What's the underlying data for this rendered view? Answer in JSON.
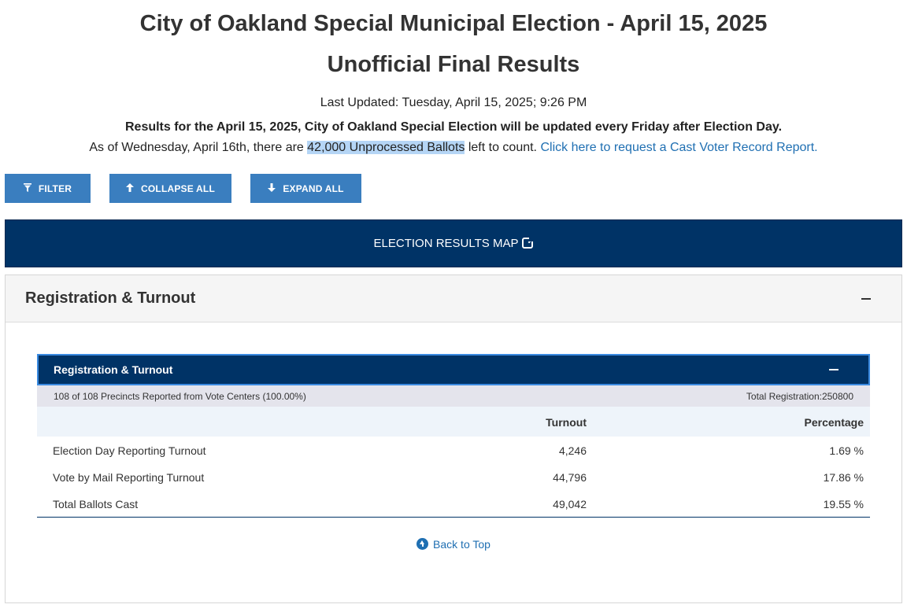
{
  "header": {
    "title": "City of Oakland Special Municipal Election - April 15, 2025",
    "subtitle": "Unofficial Final Results",
    "last_updated": "Last Updated: Tuesday, April 15, 2025; 9:26 PM",
    "bold_note": "Results for the April 15, 2025, City of Oakland Special Election will be updated every Friday after Election Day.",
    "as_of_prefix": "As of Wednesday, April 16th, there are ",
    "as_of_highlight": "42,000 Unprocessed Ballots",
    "as_of_suffix": " left to count. ",
    "cvr_link": "Click here to request a Cast Voter Record Report."
  },
  "toolbar": {
    "filter_label": "FILTER",
    "collapse_label": "COLLAPSE ALL",
    "expand_label": "EXPAND ALL"
  },
  "map_bar": {
    "label": "ELECTION RESULTS MAP"
  },
  "panel": {
    "title": "Registration & Turnout",
    "inner_title": "Registration & Turnout",
    "precincts": "108 of 108 Precincts Reported from Vote Centers (100.00%)",
    "total_registration": "Total Registration:250800",
    "columns": {
      "turnout": "Turnout",
      "percentage": "Percentage"
    },
    "rows": [
      {
        "label": "Election Day Reporting Turnout",
        "turnout": "4,246",
        "percentage": "1.69 %"
      },
      {
        "label": "Vote by Mail Reporting Turnout",
        "turnout": "44,796",
        "percentage": "17.86 %"
      },
      {
        "label": "Total Ballots Cast",
        "turnout": "49,042",
        "percentage": "19.55 %"
      }
    ],
    "back_to_top": "Back to Top"
  },
  "icons": {
    "filter": "filter-icon",
    "collapse": "arrow-up-icon",
    "expand": "arrow-down-icon",
    "external": "external-link-icon",
    "back_top": "circle-arrow-up-icon"
  },
  "colors": {
    "navy": "#003366",
    "button_blue": "#3a7ebf",
    "link_blue": "#1f6fb2",
    "highlight": "#b5d5f5"
  }
}
